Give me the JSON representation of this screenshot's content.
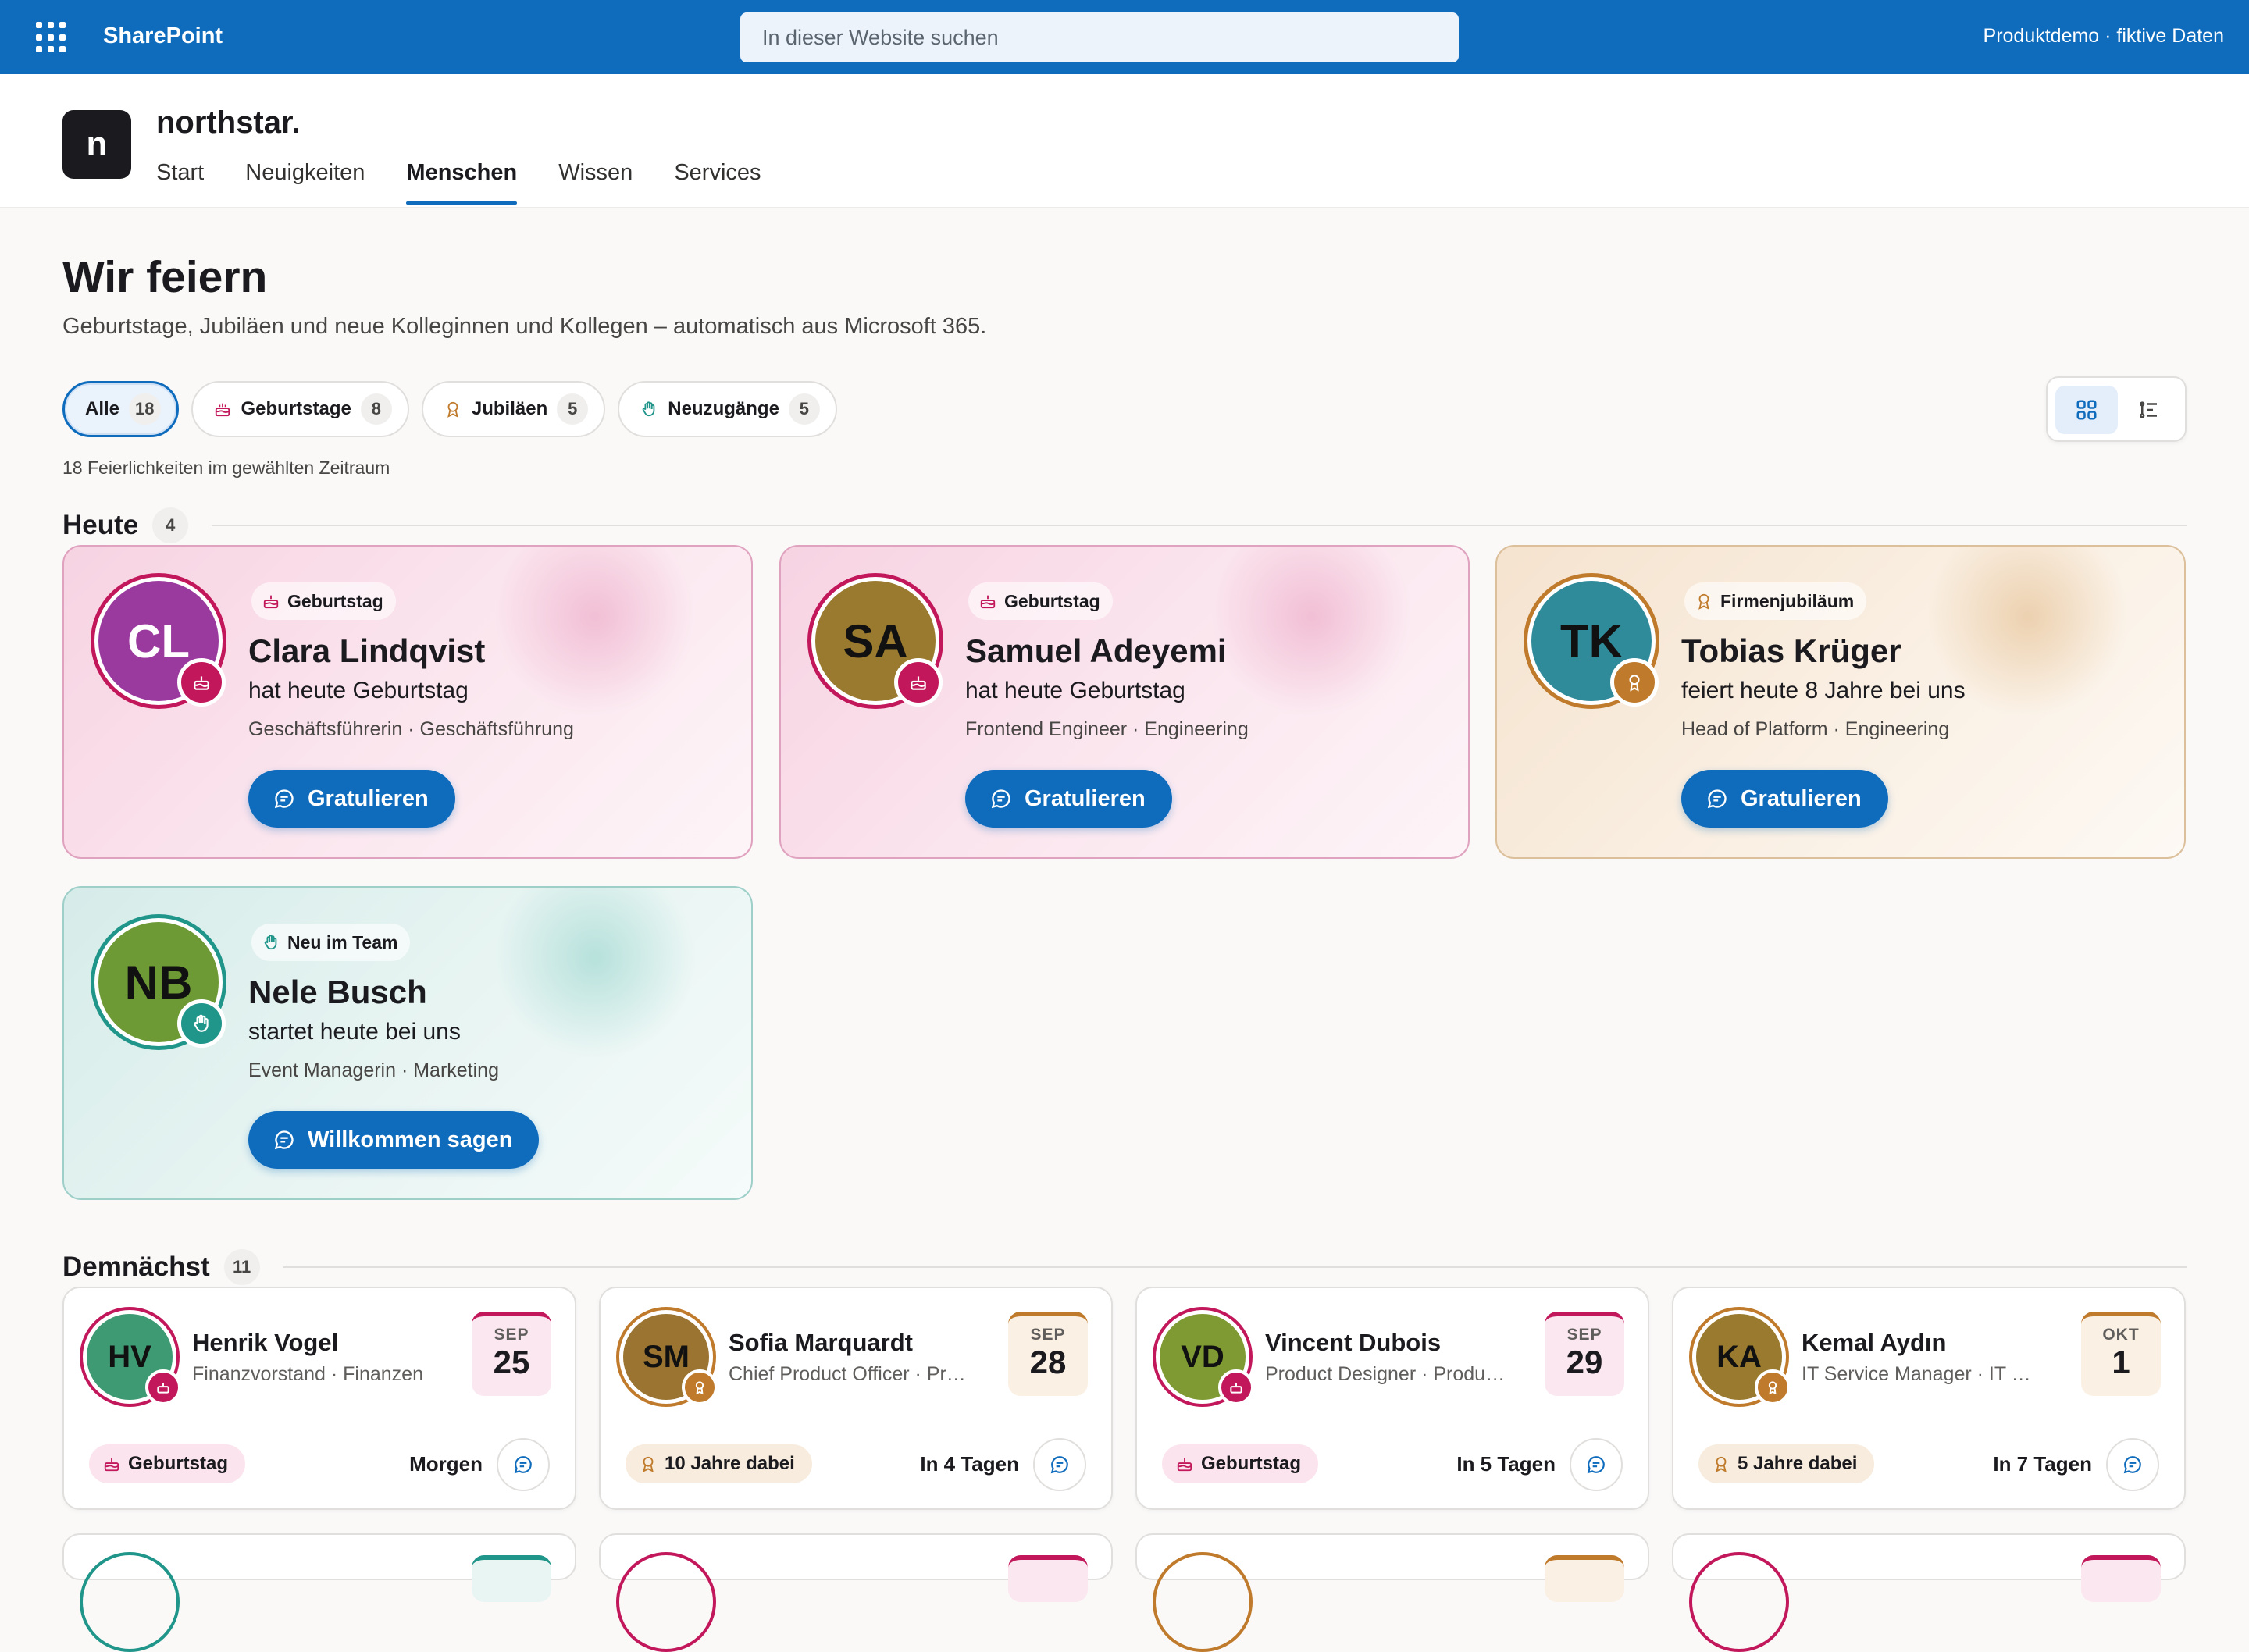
{
  "suite": {
    "app_name": "SharePoint",
    "search_placeholder": "In dieser Website suchen",
    "right_text": "Produktdemo · fiktive Daten"
  },
  "site": {
    "logo_letter": "n",
    "title": "northstar.",
    "nav": [
      {
        "label": "Start"
      },
      {
        "label": "Neuigkeiten"
      },
      {
        "label": "Menschen",
        "active": true
      },
      {
        "label": "Wissen"
      },
      {
        "label": "Services"
      }
    ]
  },
  "page": {
    "title": "Wir feiern",
    "subtitle": "Geburtstage, Jubiläen und neue Kolleginnen und Kollegen – automatisch aus Microsoft 365."
  },
  "filters": [
    {
      "label": "Alle",
      "count": "18",
      "active": true
    },
    {
      "label": "Geburtstage",
      "count": "8",
      "icon": "cake-icon"
    },
    {
      "label": "Jubiläen",
      "count": "5",
      "icon": "award-icon"
    },
    {
      "label": "Neuzugänge",
      "count": "5",
      "icon": "wave-hand-icon"
    }
  ],
  "result_count": "18 Feierlichkeiten im gewählten Zeitraum",
  "colors": {
    "primary": "#0f6cbd",
    "birthday": "#c2185b",
    "jubilee": "#c07a2b",
    "new": "#20958a"
  },
  "today": {
    "heading": "Heute",
    "count": "4",
    "cards": [
      {
        "initials": "CL",
        "tag": "Geburtstag",
        "name": "Clara Lindqvist",
        "desc": "hat heute Geburtstag",
        "role": "Geschäftsführerin · Geschäftsführung",
        "cta": "Gratulieren",
        "avatar_color": "#9b3a9e"
      },
      {
        "initials": "SA",
        "tag": "Geburtstag",
        "name": "Samuel Adeyemi",
        "desc": "hat heute Geburtstag",
        "role": "Frontend Engineer · Engineering",
        "cta": "Gratulieren",
        "avatar_color": "#9a7a2e"
      },
      {
        "initials": "TK",
        "tag": "Firmenjubiläum",
        "name": "Tobias Krüger",
        "desc": "feiert heute 8 Jahre bei uns",
        "role": "Head of Platform · Engineering",
        "cta": "Gratulieren",
        "avatar_color": "#2f8a9a"
      },
      {
        "initials": "NB",
        "tag": "Neu im Team",
        "name": "Nele Busch",
        "desc": "startet heute bei uns",
        "role": "Event Managerin · Marketing",
        "cta": "Willkommen sagen",
        "avatar_color": "#6d9a34"
      }
    ]
  },
  "upcoming": {
    "heading": "Demnächst",
    "count": "11",
    "cards": [
      {
        "initials": "HV",
        "name": "Henrik Vogel",
        "role": "Finanzvorstand · Finanzen",
        "month": "SEP",
        "day": "25",
        "tag": "Geburtstag",
        "when": "Morgen",
        "avatar_color": "#3e9a72"
      },
      {
        "initials": "SM",
        "name": "Sofia Marquardt",
        "role": "Chief Product Officer · Pro…",
        "month": "SEP",
        "day": "28",
        "tag": "10 Jahre dabei",
        "when": "In 4 Tagen",
        "avatar_color": "#9a7430"
      },
      {
        "initials": "VD",
        "name": "Vincent Dubois",
        "role": "Product Designer · Produ…",
        "month": "SEP",
        "day": "29",
        "tag": "Geburtstag",
        "when": "In 5 Tagen",
        "avatar_color": "#7f9a32"
      },
      {
        "initials": "KA",
        "name": "Kemal Aydın",
        "role": "IT Service Manager · IT & …",
        "month": "OKT",
        "day": "1",
        "tag": "5 Jahre dabei",
        "when": "In 7 Tagen",
        "avatar_color": "#9a7a2e"
      }
    ]
  }
}
